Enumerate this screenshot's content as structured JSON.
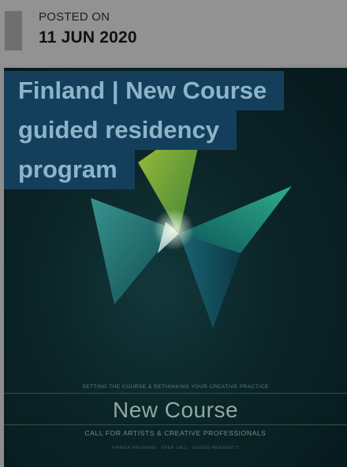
{
  "post": {
    "posted_label": "POSTED ON",
    "date": "11 JUN 2020"
  },
  "article": {
    "title_lines": [
      "Finland | New Course",
      "guided residency",
      "program"
    ]
  },
  "poster": {
    "tagline": "SETTING THE COURSE & RETHINKING YOUR CREATIVE PRACTICE",
    "brand": "New Course",
    "call": "CALL FOR ARTISTS & CREATIVE PROFESSIONALS",
    "fine_print": "FINNISH PROGRAM · OPEN CALL · GUIDED RESIDENCY"
  },
  "colors": {
    "title_background": "#143f5c",
    "title_text": "#8eb4c9",
    "poster_background": "#0b2427"
  }
}
